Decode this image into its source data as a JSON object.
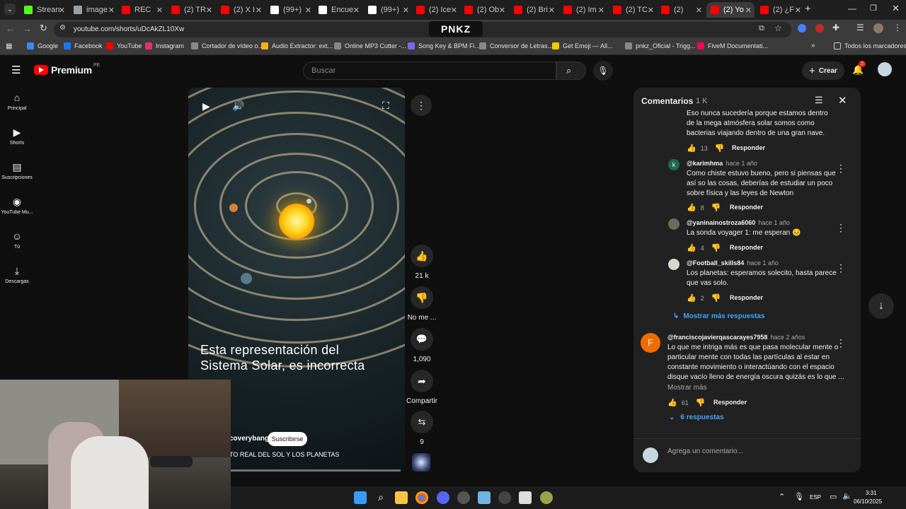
{
  "browser": {
    "tabs": [
      {
        "label": "Strean",
        "color": "#53fc18"
      },
      {
        "label": "image",
        "color": "#9aa0a6"
      },
      {
        "label": "REC",
        "color": "#ff0000"
      },
      {
        "label": "(2) TR",
        "color": "#ff0000"
      },
      {
        "label": "(2) X I",
        "color": "#ff0000"
      },
      {
        "label": "(99+) ",
        "color": "#ffffff"
      },
      {
        "label": "Encue",
        "color": "#ffffff"
      },
      {
        "label": "(99+) ",
        "color": "#ffffff"
      },
      {
        "label": "(2) Ice",
        "color": "#ff0000"
      },
      {
        "label": "(2) Ob",
        "color": "#ff0000"
      },
      {
        "label": "(2) Bri",
        "color": "#ff0000"
      },
      {
        "label": "(2) Im",
        "color": "#ff0000"
      },
      {
        "label": "(2) TC",
        "color": "#ff0000"
      },
      {
        "label": "(2) ",
        "color": "#ff0000"
      },
      {
        "label": "(2) Yo",
        "color": "#ff0000"
      },
      {
        "label": "(2) ¿F",
        "color": "#ff0000"
      }
    ],
    "active_tab": 14,
    "url": "youtube.com/shorts/uDcAkZL10Xw",
    "overlay_logo": "PNKZ",
    "bookmarks": [
      {
        "label": "Google",
        "color": "#4285f4"
      },
      {
        "label": "Facebook",
        "color": "#1877f2"
      },
      {
        "label": "YouTube",
        "color": "#ff0000"
      },
      {
        "label": "Instagram",
        "color": "#e1306c"
      },
      {
        "label": "Cortador de vídeo o...",
        "color": "#888888"
      },
      {
        "label": "Audio Extractor: ext...",
        "color": "#f2b01e"
      },
      {
        "label": "Online MP3 Cutter -...",
        "color": "#888888"
      },
      {
        "label": "Song Key & BPM Fi...",
        "color": "#7b68ee"
      },
      {
        "label": "Conversor de Letras...",
        "color": "#888888"
      },
      {
        "label": "Get Emoji — All...",
        "color": "#f7c800"
      },
      {
        "label": "pnkz_Oficial - Trigg...",
        "color": "#888888"
      },
      {
        "label": "FiveM Documentati...",
        "color": "#f40552"
      }
    ],
    "all_bookmarks": "Todos los marcadores"
  },
  "youtube": {
    "logo": "Premium",
    "region": "PE",
    "search_placeholder": "Buscar",
    "create_label": "Crear",
    "notif_count": "2",
    "sidebar": [
      {
        "label": "Principal",
        "icon": "home-icon"
      },
      {
        "label": "Shorts",
        "icon": "shorts-icon"
      },
      {
        "label": "Suscripciones",
        "icon": "subscriptions-icon"
      },
      {
        "label": "YouTube Mu...",
        "icon": "music-icon"
      },
      {
        "label": "Tú",
        "icon": "you-icon"
      },
      {
        "label": "Descargas",
        "icon": "download-icon"
      }
    ]
  },
  "short": {
    "caption": [
      "Esta representación del",
      "Sistema Solar, es incorrecta"
    ],
    "channel": "coverybang",
    "subscribe": "Suscribirse",
    "title": "TO REAL DEL SOL Y LOS PLANETAS",
    "actions": {
      "likes": "21 k",
      "dislike": "No me ...",
      "comments": "1,090",
      "share": "Compartir",
      "remix": "9"
    }
  },
  "comments_panel": {
    "title": "Comentarios",
    "count": "1 K",
    "items": [
      {
        "text": [
          "Eso nunca sucedería  porque  estamos dentro",
          "de la mega atmósfera  solar somos como",
          "bacterias  viajando dentro de una gran nave."
        ],
        "likes": "13",
        "reply": "Responder"
      },
      {
        "user": "@karimhma",
        "time": "hace 1 año",
        "text": [
          "Como chiste estuvo bueno, pero si piensas que",
          "así so las cosas, deberías de estudiar un poco",
          "sobre física y las leyes de Newton"
        ],
        "likes": "8",
        "reply": "Responder",
        "avatar_letter": "k",
        "avatar_color": "#1e6b4f"
      },
      {
        "user": "@yaninainostroza6060",
        "time": "hace 1 año",
        "text": [
          "La sonda voyager 1: me esperan 😣"
        ],
        "likes": "4",
        "reply": "Responder"
      },
      {
        "user": "@Football_skills84",
        "time": "hace 1 año",
        "text": [
          "Los planetas: esperamos solecito, hasta parece",
          "que vas solo."
        ],
        "likes": "2",
        "reply": "Responder"
      },
      {
        "more_replies": "Mostrar más respuestas"
      },
      {
        "user": "@franciscojavierqascarayes7958",
        "time": "hace 2 años",
        "text": [
          "Lo que me intriga más es que pasa molecular mente o",
          "particular mente con todas las partículas al estar en",
          "constante movimiento o interactúando con el espacio",
          "disque vacío lleno de energía oscura quizás es lo que ..."
        ],
        "show_more": "Mostrar más",
        "likes": "61",
        "reply": "Responder",
        "replies_count": "6 respuestas",
        "avatar_letter": "F",
        "avatar_color": "#ef6c00"
      }
    ],
    "add_comment_placeholder": "Agrega un comentario..."
  },
  "taskbar": {
    "lang": "ESP",
    "time": "3:31",
    "date": "06/10/2025"
  }
}
